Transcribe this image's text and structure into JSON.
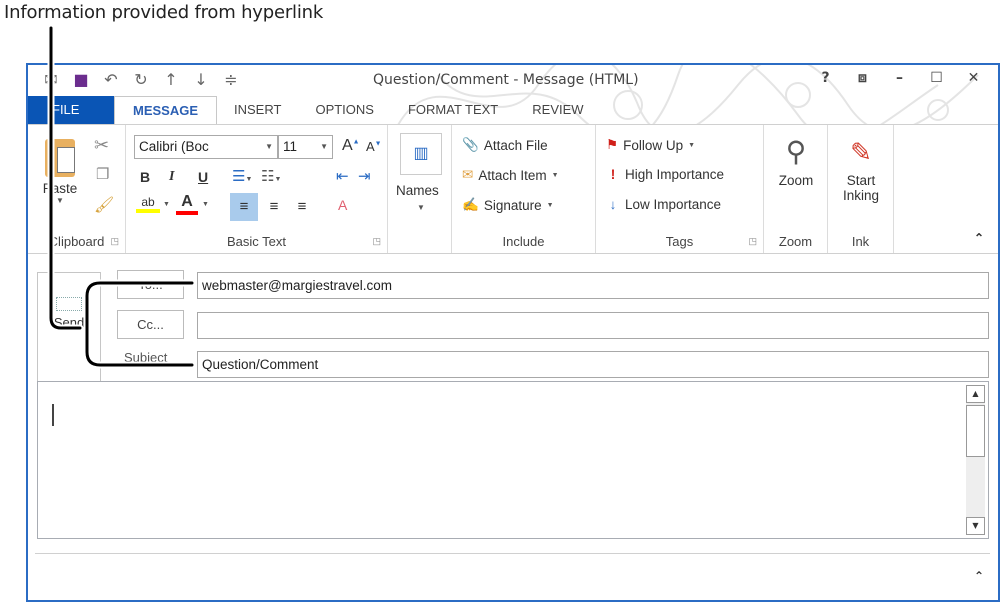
{
  "caption": "Information provided from hyperlink",
  "window": {
    "title": "Question/Comment - Message (HTML)",
    "controls": {
      "help": "?",
      "restore_ribbon": "⧈",
      "minimize": "–",
      "maximize": "☐",
      "close": "✕"
    },
    "qat_icons": [
      "outlook-icon",
      "save-icon",
      "undo-icon",
      "redo-icon",
      "previous-item-icon",
      "next-item-icon",
      "customize-qat-icon"
    ]
  },
  "tabs": [
    {
      "label": "FILE"
    },
    {
      "label": "MESSAGE",
      "active": true
    },
    {
      "label": "INSERT"
    },
    {
      "label": "OPTIONS"
    },
    {
      "label": "FORMAT TEXT"
    },
    {
      "label": "REVIEW"
    }
  ],
  "ribbon": {
    "clipboard": {
      "label": "Clipboard",
      "paste": "Paste"
    },
    "basic_text": {
      "label": "Basic Text",
      "font": "Calibri (Boc",
      "size": "11",
      "bold": "B",
      "italic": "I",
      "underline": "U",
      "highlight_color": "#ffff00",
      "font_color": "#ff0000"
    },
    "names": {
      "label": "Names"
    },
    "include": {
      "label": "Include",
      "attach_file": "Attach File",
      "attach_item": "Attach Item",
      "signature": "Signature"
    },
    "tags": {
      "label": "Tags",
      "follow_up": "Follow Up",
      "high_importance": "High Importance",
      "low_importance": "Low Importance"
    },
    "zoom": {
      "label": "Zoom",
      "button": "Zoom"
    },
    "ink": {
      "label": "Ink",
      "button_line1": "Start",
      "button_line2": "Inking"
    }
  },
  "form": {
    "send": "Send",
    "to_label": "To...",
    "cc_label": "Cc...",
    "subject_label": "Subject",
    "to_value": "webmaster@margiestravel.com",
    "cc_value": "",
    "subject_value": "Question/Comment",
    "body": ""
  },
  "colors": {
    "accent": "#2b6cc4",
    "file_tab": "#0a55b5",
    "active_tab_text": "#2b5fb3"
  }
}
